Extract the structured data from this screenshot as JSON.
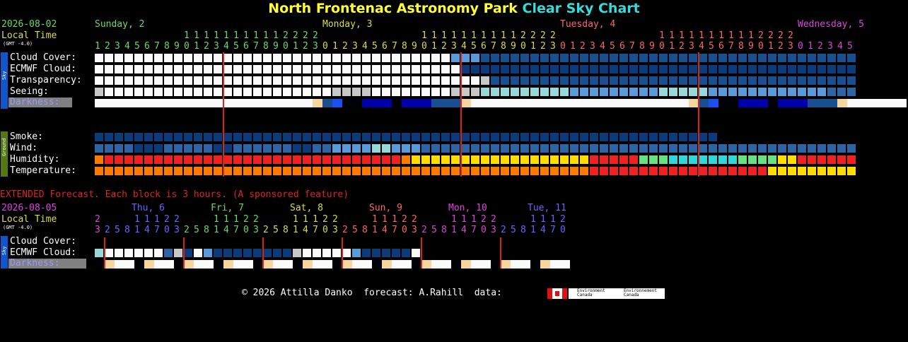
{
  "title": {
    "part1": "North Frontenac Astronomy Park",
    "part2": "Clear Sky Chart"
  },
  "main": {
    "date": "2026-08-02",
    "local_time": "Local Time",
    "gmt": "(GMT -4.0)",
    "days": [
      {
        "label": "Sunday, 2",
        "color": "#66dd66"
      },
      {
        "label": "Monday, 3",
        "color": "#dddd44"
      },
      {
        "label": "Tuesday, 4",
        "color": "#ff6666"
      },
      {
        "label": "Wednesday, 5",
        "color": "#dd44dd"
      }
    ],
    "first_hour": 1,
    "hour_blocks": 77,
    "rows": {
      "cloud": "Cloud Cover:",
      "ecmwf": "ECMWF Cloud:",
      "transp": "Transparency:",
      "seeing": "Seeing:",
      "darkness": "Darkness:",
      "smoke": "Smoke:",
      "wind": "Wind:",
      "humidity": "Humidity:",
      "temp": "Temperature:"
    },
    "sky_tag": "Sky",
    "ground_tag": "Ground"
  },
  "extended": {
    "heading": "EXTENDED Forecast. Each block is 3 hours. (A sponsored feature)",
    "date": "2026-08-05",
    "local_time": "Local Time",
    "gmt": "(GMT -4.0)",
    "days": [
      {
        "label": "Thu, 6",
        "color": "#6666ff"
      },
      {
        "label": "Fri, 7",
        "color": "#66dd66"
      },
      {
        "label": "Sat, 8",
        "color": "#dddd44"
      },
      {
        "label": "Sun, 9",
        "color": "#ff6666"
      },
      {
        "label": "Mon, 10",
        "color": "#dd44dd"
      },
      {
        "label": "Tue, 11",
        "color": "#6666ff"
      }
    ],
    "hours": [
      23,
      2,
      5,
      8,
      11,
      14,
      17,
      20,
      23,
      2,
      5,
      8,
      11,
      14,
      17,
      20,
      23,
      2,
      5,
      8,
      11,
      14,
      17,
      20,
      23,
      2,
      5,
      8,
      11,
      14,
      17,
      20,
      23,
      2,
      5,
      8,
      11,
      14,
      17,
      20,
      23,
      2,
      5,
      8,
      11,
      14,
      17,
      20,
      23,
      2,
      5,
      8,
      11,
      14,
      17,
      20,
      23,
      2,
      5,
      8,
      11,
      14,
      17,
      20,
      23,
      2,
      5,
      8,
      11,
      14,
      17,
      20
    ],
    "rows": {
      "cloud": "Cloud Cover:",
      "ecmwf": "ECMWF Cloud:",
      "darkness": "Darkness:"
    },
    "sky_tag": "Sky"
  },
  "footer": {
    "text": "© 2026 Attilla Danko  forecast: A.Rahill  data:",
    "logo1": "Environment Canada",
    "logo2": "Environnement Canada"
  },
  "chart_data": {
    "type": "heatmap",
    "colors": {
      "white": "#fafafa",
      "lightgray": "#c8c8c8",
      "lightblue": "#5a9ad8",
      "midblue": "#2e64a4",
      "darkblue": "#1a4f8f",
      "navy": "#0d3a78",
      "cyan": "#98d8d8",
      "skyblue": "#6aa6e6",
      "red": "#ee2222",
      "orange": "#ff7a00",
      "yellow": "#ffdd00",
      "green": "#66e080",
      "teal": "#33d6d6",
      "peach": "#f7d7a0",
      "black": "#000008",
      "deepblue": "#0000a8",
      "blue": "#1a50f0",
      "midnight": "#000060"
    },
    "main_series": {
      "cloud": "wwwwwwwwwwwwwwwwwwwwwwwwwwwwwwwwwwwwLLLbbbbbbbbbbbbbbbbbbbbbbbbbbbbbbbbbbbbbbbbbbbbbbbbbbbbbbbb",
      "ecmwf": "wwwwwwwwwwwwwwwwwwwwwwwwwwwwwwwwwwwwwnnnnnnnnnnnnnnnnnnnnnnnnnnnnnnnnnnnnnnnnnnnnnnnnnnnnnnnnnnnnnn",
      "transp": "wwwwwwwwwwwwwwwwwwwwwwwwwwwwwwwwwwwwwwwgbbbbbbbbbbbbbbbbbbbbbbbbbbbbbbbbbbbbbbbbbbbbbbbbbbbbbbbbb",
      "seeing": "gwwwwwwwwwwwwwwwwwwwwwwwggggwwwwwwwwgggcccccccccLLLLLLLLLcccccLLLLLLLLLLLLmmmLLLLLLLLLLLLLLLLLLLLLLL",
      "darkness": "wwwwwwwwwwwwwwwwwwwwwwpbBkkdddkdddbbbpwwwwwwwwwwwwwwwwwwwwwwpbBkkdddkdddbbbpwwwwwwwwwwwwwwwwwwwpb",
      "smoke": "nnnnnnnnnnnnnnnnnnnnnnnnnnnnnnnnnnnnnnnnnnnnnnnnnnnnnnnnnnnnnnn..............................",
      "wind": "mmmmnnnmmmmmnnmmmmmmnnmmLLLLccLLLmmmmmmmmmmmmmmmmmmmmmmmmmmmmmmmmmmmmmmmmmmmmmmmmmmmmmmmmmmmmmm",
      "humidity": "orrrrrrrrrrrrrrrrrrrrrrrrrrrrrroyyyyyyyyyyyyyyyyyyrrrrrGGGTTTTTTTGGGGyyrrrrrrrrrooyyGGGTTTTTGGGyy",
      "temp": "oooooooooooooooooooooooooooooooooooooooooooooooooorrrrrrrrrrrrrrrrrryyyyyyyyyyoooooooooooooooorrrr"
    },
    "ext_series": {
      "cloud": "cwwwwwwmgnwLnnnnnnnngwwwwwLnnnnnw",
      "ecmwf": "cwwwwwwmgnwLnnnnnnnngwwwwwLnnnnnw",
      "darkness": "kpwwkpwwkpwwkpwwkpwwkpwwkpwwkpwwkpwwkpwwkpwwkpwwkpwwkpwwkpwwkpwwkpwwkpww"
    }
  }
}
